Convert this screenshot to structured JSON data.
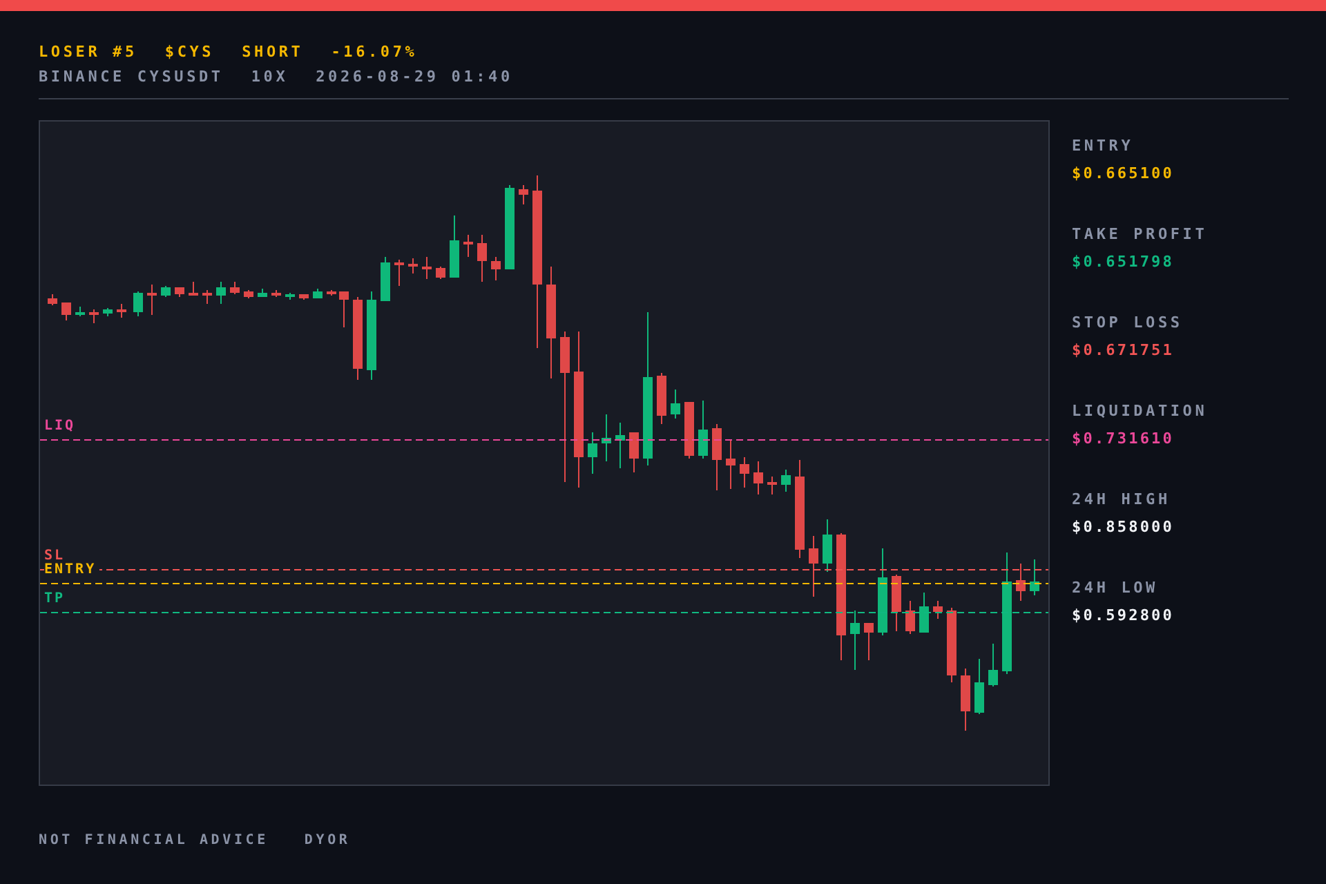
{
  "header": {
    "title_parts": [
      "LOSER #5",
      "$CYS",
      "SHORT",
      "-16.07%"
    ],
    "meta_parts": [
      "BINANCE CYSUSDT",
      "10X",
      "2026-08-29 01:40"
    ]
  },
  "chart": {
    "levels": [
      {
        "label": "LIQ",
        "color": "#ec4899"
      },
      {
        "label": "SL",
        "color": "#f05454"
      },
      {
        "label": "ENTRY",
        "color": "#f5b800"
      },
      {
        "label": "TP",
        "color": "#10b981"
      }
    ]
  },
  "stats": [
    {
      "label": "ENTRY",
      "value": "$0.665100",
      "color": "#f5b800"
    },
    {
      "label": "TAKE PROFIT",
      "value": "$0.651798",
      "color": "#10b981"
    },
    {
      "label": "STOP LOSS",
      "value": "$0.671751",
      "color": "#f05454"
    },
    {
      "label": "LIQUIDATION",
      "value": "$0.731610",
      "color": "#ec4899"
    },
    {
      "label": "24H HIGH",
      "value": "$0.858000",
      "color": "#f1f3f7"
    },
    {
      "label": "24H LOW",
      "value": "$0.592800",
      "color": "#f1f3f7"
    }
  ],
  "footer": [
    "NOT FINANCIAL ADVICE",
    "DYOR"
  ]
}
